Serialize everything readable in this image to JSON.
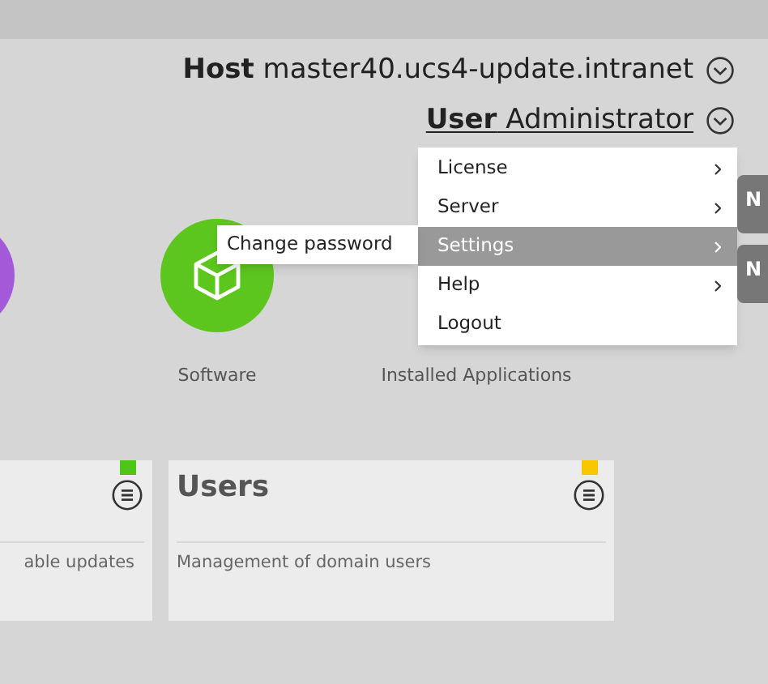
{
  "header": {
    "host_label": "Host",
    "host_value": "master40.ucs4-update.intranet",
    "user_label": "User",
    "user_value": "Administrator"
  },
  "user_menu": [
    {
      "label": "License",
      "has_submenu": true,
      "selected": false
    },
    {
      "label": "Server",
      "has_submenu": true,
      "selected": false
    },
    {
      "label": "Settings",
      "has_submenu": true,
      "selected": true
    },
    {
      "label": "Help",
      "has_submenu": true,
      "selected": false
    },
    {
      "label": "Logout",
      "has_submenu": false,
      "selected": false
    }
  ],
  "submenu": [
    {
      "label": "Change password",
      "selected": false
    }
  ],
  "side_tabs": [
    {
      "label": "N"
    },
    {
      "label": "N"
    }
  ],
  "apps": [
    {
      "color": "#a45ad8"
    },
    {
      "label": "Software",
      "color": "#5cc61e"
    },
    {
      "label": "Installed Applications"
    }
  ],
  "cards": [
    {
      "description": "able updates",
      "color": "#4fc518"
    },
    {
      "title": "Users",
      "description": "Management of domain users",
      "color": "#f8c700"
    }
  ]
}
